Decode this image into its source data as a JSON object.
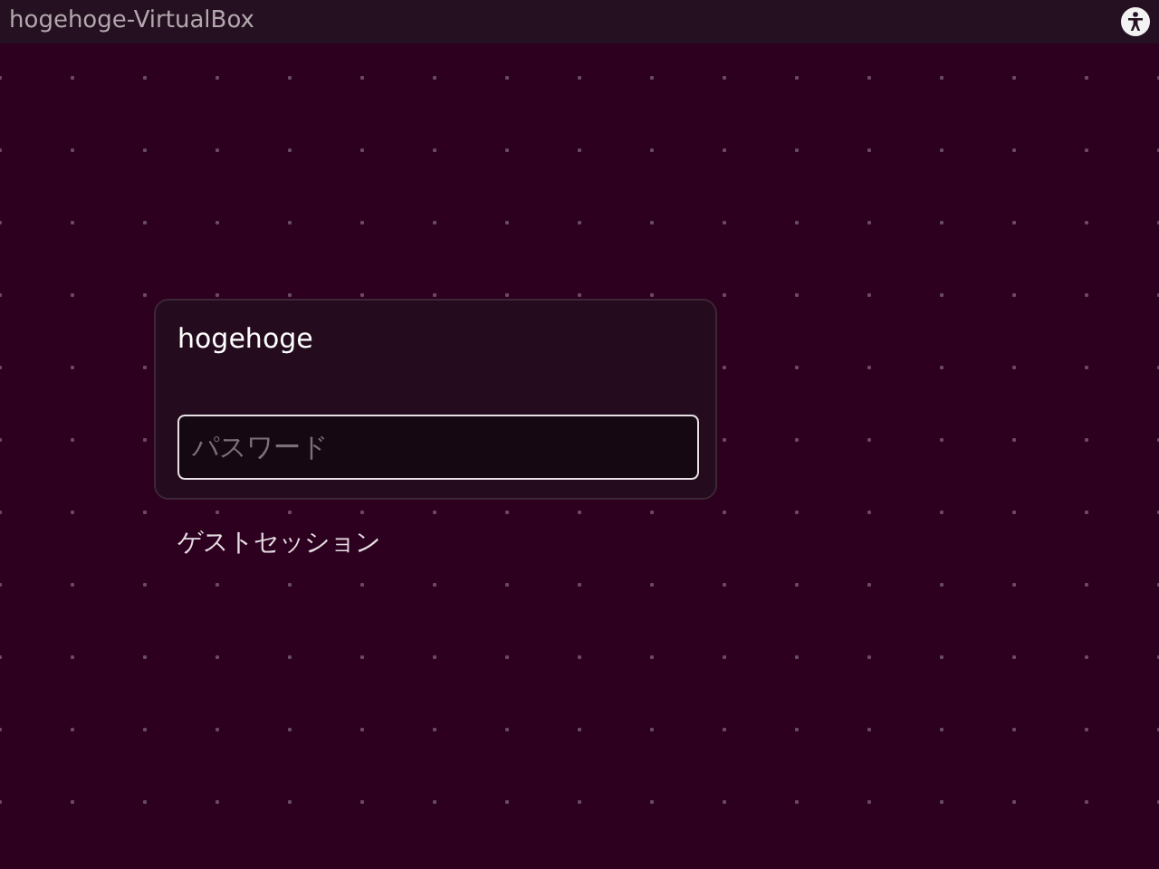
{
  "top_bar": {
    "hostname": "hogehoge-VirtualBox"
  },
  "login": {
    "username": "hogehoge",
    "password_field": {
      "placeholder": "パスワード"
    },
    "guest_session": "ゲストセッション"
  }
}
